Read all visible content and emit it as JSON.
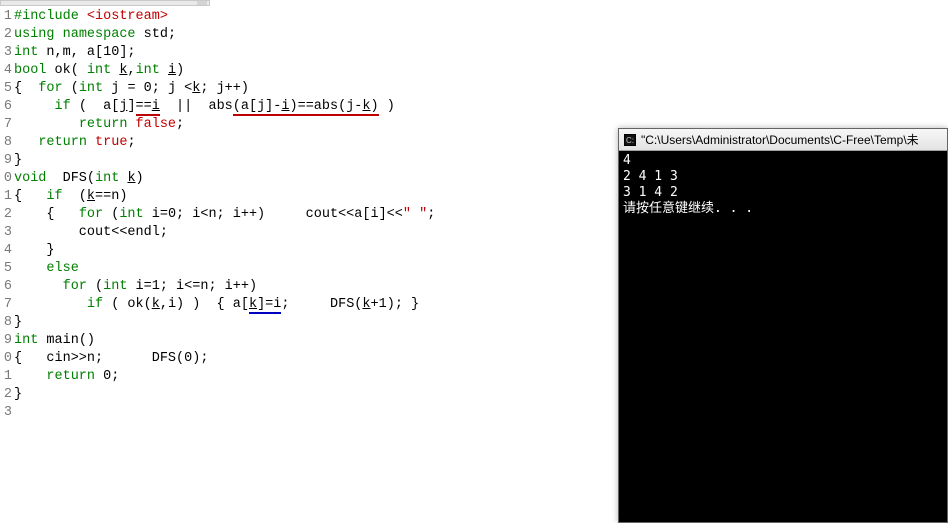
{
  "editor": {
    "lines": [
      {
        "n": "1",
        "html": "<span class='mac'>#include</span> <span class='str'>&lt;iostream&gt;</span>"
      },
      {
        "n": "2",
        "html": "<span class='kw'>using</span> <span class='kw'>namespace</span> std;"
      },
      {
        "n": "3",
        "html": "<span class='kw'>int</span> n,m, a[10];"
      },
      {
        "n": "4",
        "html": "<span class='kw'>bool</span> ok( <span class='kw'>int</span> <u>k</u>,<span class='kw'>int</span> <u>i</u>)"
      },
      {
        "n": "5",
        "html": "{  <span class='kw'>for</span> (<span class='kw'>int</span> j = 0; j &lt;<u>k</u>; j++)"
      },
      {
        "n": "6",
        "html": "     <span class='kw'>if</span> (  a[<u>j</u>]<span class='uRed'>==<u>i</u></span>  ||  abs<span class='uRed'>(a[j]-<u>i</u>)==abs(j-<u>k</u>)</span> )"
      },
      {
        "n": "7",
        "html": "        <span class='kw'>return</span> <span class='red'>false</span>;"
      },
      {
        "n": "8",
        "html": "   <span class='kw'>return</span> <span class='red'>true</span>;"
      },
      {
        "n": "9",
        "html": "}"
      },
      {
        "n": "0",
        "html": "<span class='kw'>void</span>  DFS(<span class='kw'>int</span> <u>k</u>)"
      },
      {
        "n": "1",
        "html": "{   <span class='kw'>if</span>  (<u>k</u>==n)"
      },
      {
        "n": "2",
        "html": "    {   <span class='kw'>for</span> (<span class='kw'>int</span> i=0; i&lt;n; i++)     cout&lt;&lt;a[i]&lt;&lt;<span class='str'>\" \"</span>;"
      },
      {
        "n": "3",
        "html": "        cout&lt;&lt;endl;"
      },
      {
        "n": "4",
        "html": "    }"
      },
      {
        "n": "5",
        "html": "    <span class='kw'>else</span>"
      },
      {
        "n": "6",
        "html": "      <span class='kw'>for</span> (<span class='kw'>int</span> i=1; i&lt;=n; i++)"
      },
      {
        "n": "7",
        "html": "         <span class='kw'>if</span> ( ok(<u>k</u>,i) )  { a[<span class='uBlue'><u>k</u>]=i</span>;     DFS(<u>k</u>+1); }"
      },
      {
        "n": "8",
        "html": "}"
      },
      {
        "n": "9",
        "html": "<span class='kw'>int</span> main()"
      },
      {
        "n": "0",
        "html": "{   cin&gt;&gt;n;      DFS(0);"
      },
      {
        "n": "1",
        "html": "    <span class='kw'>return</span> 0;"
      },
      {
        "n": "2",
        "html": "}"
      },
      {
        "n": "3",
        "html": ""
      }
    ]
  },
  "console": {
    "title": "\"C:\\Users\\Administrator\\Documents\\C-Free\\Temp\\未",
    "output": [
      "4",
      "2 4 1 3",
      "3 1 4 2",
      "请按任意键继续. . ."
    ]
  }
}
